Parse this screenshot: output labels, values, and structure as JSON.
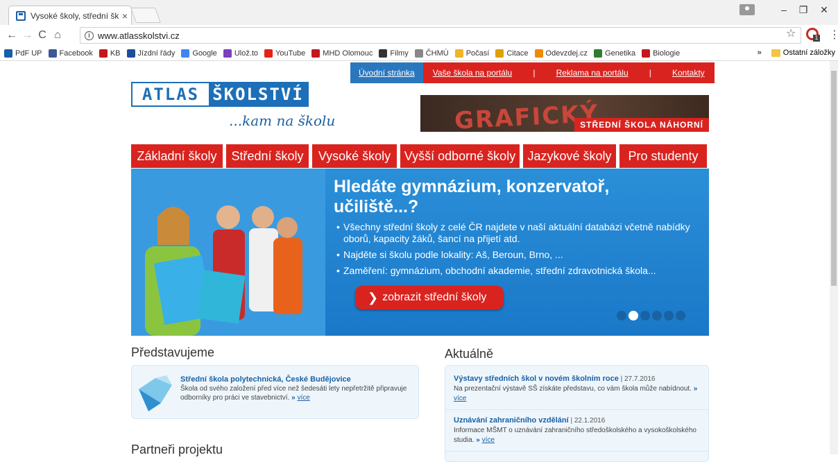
{
  "browser": {
    "tab_title": "Vysoké školy, střední škol",
    "tab_close": "×",
    "url": "www.atlasskolstvi.cz",
    "win_min": "–",
    "win_max": "❐",
    "win_close": "✕",
    "bookmarks": [
      {
        "label": "PdF UP",
        "color": "#1a5da8"
      },
      {
        "label": "Facebook",
        "color": "#3b5998"
      },
      {
        "label": "KB",
        "color": "#c4161c"
      },
      {
        "label": "Jízdní řády",
        "color": "#1c4e9c"
      },
      {
        "label": "Google",
        "color": "#4285f4"
      },
      {
        "label": "Ulož.to",
        "color": "#7b3fbf"
      },
      {
        "label": "YouTube",
        "color": "#e62117"
      },
      {
        "label": "MHD Olomouc",
        "color": "#c4161c"
      },
      {
        "label": "Filmy",
        "color": "#333333"
      },
      {
        "label": "ČHMÚ",
        "color": "#888888"
      },
      {
        "label": "Počasí",
        "color": "#f0b429"
      },
      {
        "label": "Citace",
        "color": "#e0a000"
      },
      {
        "label": "Odevzdej.cz",
        "color": "#f08a00"
      },
      {
        "label": "Genetika",
        "color": "#2e7d32"
      },
      {
        "label": "Biologie",
        "color": "#c4161c"
      }
    ],
    "bookmarks_more": "»",
    "other_bookmarks": "Ostatní záložky"
  },
  "topnav": {
    "home": "Úvodní stránka",
    "items": [
      "Vaše škola na portálu",
      "Reklama na portálu",
      "Kontakty"
    ],
    "separator": "|"
  },
  "logo": {
    "left": "ATLAS",
    "right": "ŠKOLSTVÍ",
    "tagline": "...kam na školu"
  },
  "banner": {
    "big": "GRAFICKÝ DESIGN",
    "small": "STŘEDNÍ ŠKOLA NÁHORNÍ"
  },
  "mainnav": [
    "Základní školy",
    "Střední školy",
    "Vysoké školy",
    "Vyšší odborné školy",
    "Jazykové školy",
    "Pro studenty"
  ],
  "hero": {
    "title_line1": "Hledáte gymnázium, konzervatoř,",
    "title_line2": "učiliště...?",
    "bullets": [
      "Všechny střední školy z celé ČR najdete v naší aktuální databázi včetně nabídky oborů, kapacity žáků, šancí na přijetí atd.",
      "Najděte si školu podle lokality: Aš, Beroun, Brno, ...",
      "Zaměření: gymnázium, obchodní akademie, střední zdravotnická škola..."
    ],
    "button": "zobrazit střední školy",
    "slide_active": 2,
    "slide_count": 6
  },
  "featured": {
    "heading": "Představujeme",
    "title": "Střední škola polytechnická, České Budějovice",
    "text": "Škola od svého založení před více než šedesáti lety nepřetržitě připravuje odborníky pro práci ve stavebnictví.",
    "more": "více"
  },
  "news": {
    "heading": "Aktuálně",
    "items": [
      {
        "title": "Výstavy středních škol v novém školním roce",
        "date": "| 27.7.2016",
        "text": "Na prezentační výstavě SŠ získáte představu, co vám škola může nabídnout.",
        "more": "více"
      },
      {
        "title": "Uznávání zahraničního vzdělání",
        "date": "| 22.1.2016",
        "text": "Informace MŠMT o uznávání zahraničního středoškolského a vysokoškolského studia.",
        "more": "více"
      }
    ]
  },
  "partners": {
    "heading": "Partneři projektu"
  }
}
